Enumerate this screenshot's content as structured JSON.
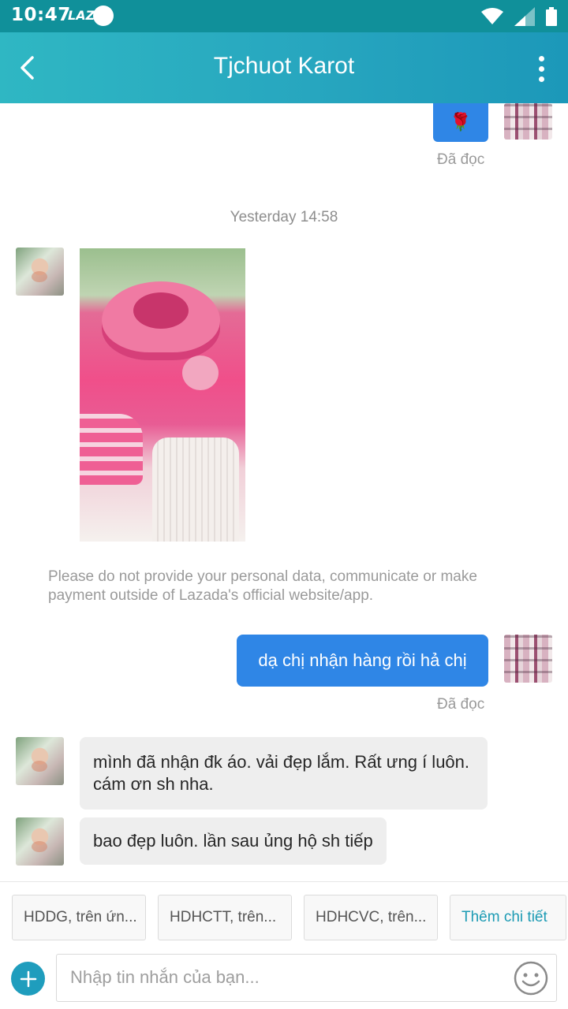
{
  "status_bar": {
    "time": "10:47",
    "app_badge": "LAZ"
  },
  "header": {
    "title": "Tjchuot Karot"
  },
  "messages": {
    "top_read": "Đã đọc",
    "timestamp": "Yesterday 14:58",
    "notice": "Please do not provide your personal data, communicate or make payment outside of Lazada's official website/app.",
    "outgoing_text": "dạ chị nhận hàng rồi hả chị",
    "outgoing_read": "Đã đọc",
    "incoming_1": "mình đã nhận đk áo. vải đẹp lắm. Rất ưng í luôn. cám ơn sh nha.",
    "incoming_2": "bao đẹp luôn. lần sau ủng hộ sh tiếp"
  },
  "quick_replies": [
    "HDDG, trên ứn...",
    "HDHCTT, trên...",
    "HDHCVC, trên...",
    "Thêm chi tiết"
  ],
  "composer": {
    "placeholder": "Nhập tin nhắn của bạn..."
  },
  "colors": {
    "header": "#27a6bf",
    "status_bar": "#10909a",
    "outgoing_bubble": "#2f86e6",
    "incoming_bubble": "#eeeeee",
    "accent": "#1d9bb4"
  }
}
